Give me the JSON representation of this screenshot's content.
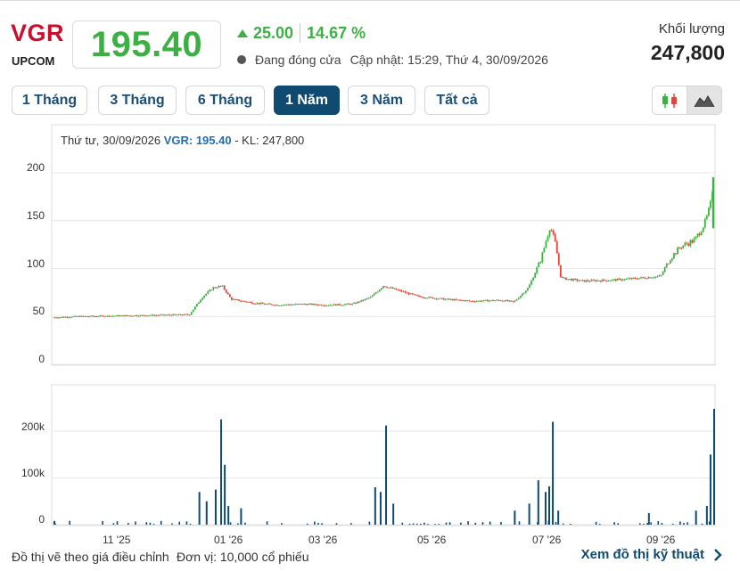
{
  "header": {
    "ticker": "VGR",
    "exchange": "UPCOM",
    "price": "195.40",
    "change": "25.00",
    "change_pct": "14.67 %",
    "status": "Đang đóng cửa",
    "updated": "Cập nhật: 15:29, Thứ 4, 30/09/2026",
    "volume_label": "Khối lượng",
    "volume_value": "247,800"
  },
  "tabs": [
    {
      "label": "1 Tháng",
      "active": false
    },
    {
      "label": "3 Tháng",
      "active": false
    },
    {
      "label": "6 Tháng",
      "active": false
    },
    {
      "label": "1 Năm",
      "active": true
    },
    {
      "label": "3 Năm",
      "active": false
    },
    {
      "label": "Tất cả",
      "active": false
    }
  ],
  "chart_types": {
    "candlestick_icon": "candlestick-icon",
    "mountain_icon": "mountain-icon",
    "selected": "mountain"
  },
  "info_line": {
    "date": "Thứ tư, 30/09/2026",
    "symbol_value": "VGR: 195.40",
    "volume": "- KL: 247,800"
  },
  "footer": {
    "adjusted_note": "Đồ thị vẽ theo giá điều chỉnh",
    "unit_note": "Đơn vị: 10,000 cổ phiếu",
    "tech_link": "Xem đồ thị kỹ thuật"
  },
  "colors": {
    "up": "#3cb043",
    "down": "#e8413c",
    "volume": "#0f4a71",
    "accent": "#0f4a71",
    "ticker": "#c8102e"
  },
  "chart_data": [
    {
      "type": "candlestick",
      "title": "",
      "ylim": [
        0,
        200
      ],
      "y_ticks": [
        "0",
        "50",
        "100",
        "150",
        "200"
      ],
      "x_ticks": [
        "11 '25",
        "01 '26",
        "03 '26",
        "05 '26",
        "07 '26",
        "09 '26"
      ],
      "grid": true,
      "last_close": 195.4,
      "close_trend": [
        [
          "2025-10-01",
          49
        ],
        [
          "2025-10-15",
          50
        ],
        [
          "2025-11-01",
          50.5
        ],
        [
          "2025-11-15",
          51
        ],
        [
          "2025-12-01",
          51.5
        ],
        [
          "2025-12-15",
          52
        ],
        [
          "2025-12-22",
          70
        ],
        [
          "2025-12-28",
          80
        ],
        [
          "2026-01-02",
          82
        ],
        [
          "2026-01-07",
          68
        ],
        [
          "2026-01-20",
          64
        ],
        [
          "2026-02-01",
          62
        ],
        [
          "2026-02-15",
          63
        ],
        [
          "2026-03-01",
          62
        ],
        [
          "2026-03-15",
          63
        ],
        [
          "2026-03-25",
          70
        ],
        [
          "2026-04-01",
          82
        ],
        [
          "2026-04-08",
          78
        ],
        [
          "2026-04-20",
          71
        ],
        [
          "2026-05-05",
          68
        ],
        [
          "2026-05-20",
          66
        ],
        [
          "2026-06-05",
          67
        ],
        [
          "2026-06-12",
          65
        ],
        [
          "2026-06-20",
          80
        ],
        [
          "2026-06-27",
          110
        ],
        [
          "2026-07-02",
          145
        ],
        [
          "2026-07-05",
          125
        ],
        [
          "2026-07-08",
          90
        ],
        [
          "2026-07-20",
          87
        ],
        [
          "2026-08-05",
          88
        ],
        [
          "2026-08-20",
          90
        ],
        [
          "2026-09-01",
          92
        ],
        [
          "2026-09-06",
          110
        ],
        [
          "2026-09-12",
          123
        ],
        [
          "2026-09-20",
          130
        ],
        [
          "2026-09-26",
          150
        ],
        [
          "2026-09-29",
          170
        ],
        [
          "2026-09-30",
          195.4
        ]
      ]
    },
    {
      "type": "bar",
      "title": "Volume",
      "ylim": [
        0,
        240000
      ],
      "y_ticks": [
        "0",
        "100k",
        "200k"
      ],
      "unit": "10,000 cổ phiếu",
      "spikes": [
        [
          "2025-10-01",
          8000
        ],
        [
          "2025-12-20",
          70000
        ],
        [
          "2025-12-24",
          50000
        ],
        [
          "2025-12-29",
          75000
        ],
        [
          "2026-01-01",
          225000
        ],
        [
          "2026-01-03",
          128000
        ],
        [
          "2026-01-05",
          40000
        ],
        [
          "2026-01-12",
          35000
        ],
        [
          "2026-03-27",
          80000
        ],
        [
          "2026-03-30",
          70000
        ],
        [
          "2026-04-02",
          212000
        ],
        [
          "2026-04-06",
          45000
        ],
        [
          "2026-06-12",
          30000
        ],
        [
          "2026-06-20",
          45000
        ],
        [
          "2026-06-25",
          95000
        ],
        [
          "2026-06-29",
          70000
        ],
        [
          "2026-07-01",
          82000
        ],
        [
          "2026-07-03",
          220000
        ],
        [
          "2026-07-06",
          30000
        ],
        [
          "2026-08-25",
          25000
        ],
        [
          "2026-09-20",
          30000
        ],
        [
          "2026-09-26",
          40000
        ],
        [
          "2026-09-28",
          150000
        ],
        [
          "2026-09-30",
          247800
        ]
      ]
    }
  ]
}
